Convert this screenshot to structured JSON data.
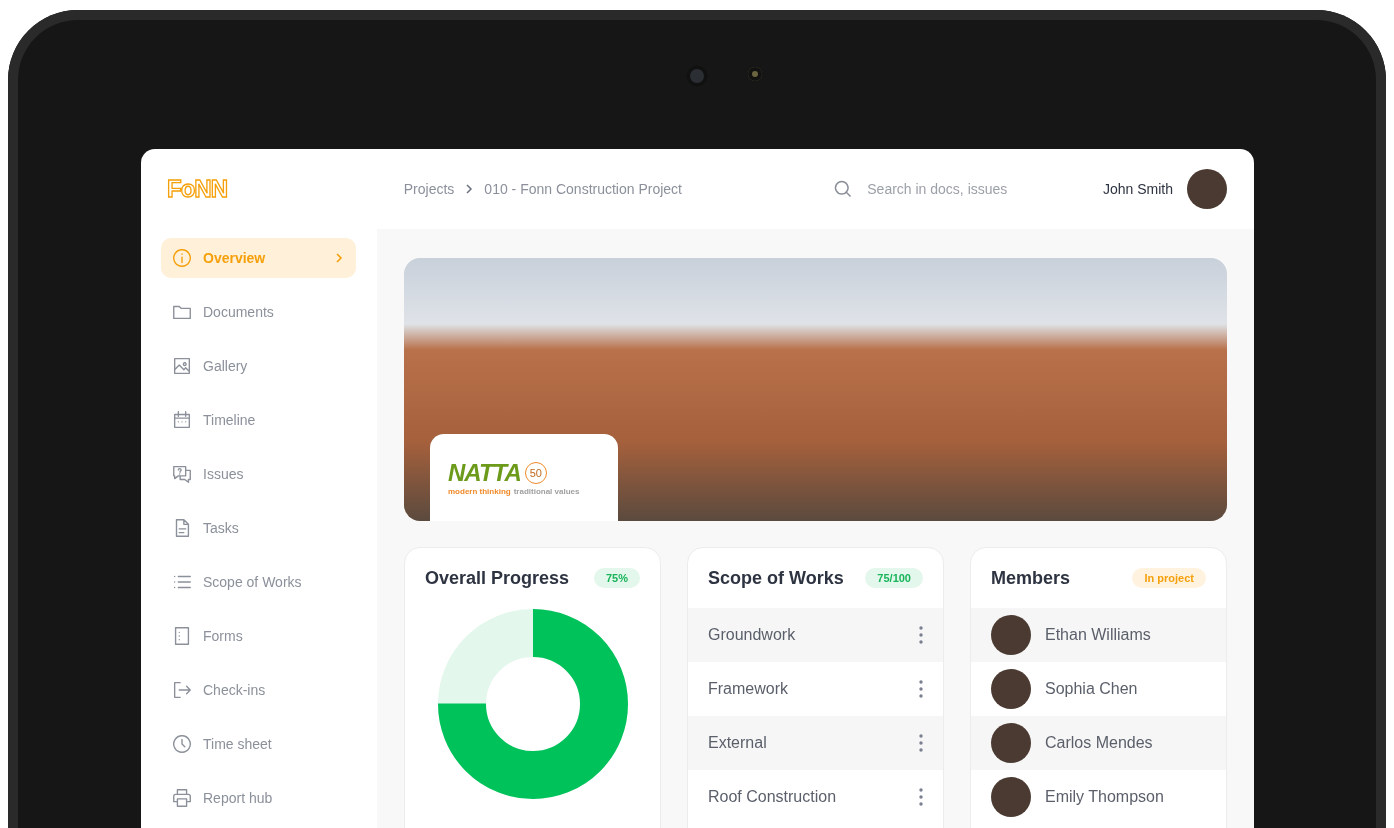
{
  "logo": "FoNN",
  "breadcrumb": [
    "Projects",
    "010 - Fonn Construction Project"
  ],
  "search": {
    "placeholder": "Search in docs, issues"
  },
  "user": {
    "name": "John Smith"
  },
  "sidebar": {
    "items": [
      {
        "label": "Overview",
        "selected": true
      },
      {
        "label": "Documents",
        "selected": false
      },
      {
        "label": "Gallery",
        "selected": false
      },
      {
        "label": "Timeline",
        "selected": false
      },
      {
        "label": "Issues",
        "selected": false
      },
      {
        "label": "Tasks",
        "selected": false
      },
      {
        "label": "Scope of Works",
        "selected": false
      },
      {
        "label": "Forms",
        "selected": false
      },
      {
        "label": "Check-ins",
        "selected": false
      },
      {
        "label": "Time sheet",
        "selected": false
      },
      {
        "label": "Report hub",
        "selected": false
      }
    ]
  },
  "banner": {
    "client_logo": {
      "name": "NATTA",
      "tagline_left": "modern thinking",
      "tagline_right": "traditional values",
      "anniversary": "50"
    }
  },
  "overall_progress": {
    "title": "Overall Progress",
    "badge": "75%",
    "level": 0.75
  },
  "scope_of_works": {
    "title": "Scope of  Works",
    "badge": "75/100",
    "items": [
      "Groundwork",
      "Framework",
      "External",
      "Roof Construction"
    ]
  },
  "members": {
    "title": "Members",
    "badge": "In project",
    "items": [
      "Ethan Williams",
      "Sophia Chen",
      "Carlos Mendes",
      "Emily Thompson"
    ]
  }
}
